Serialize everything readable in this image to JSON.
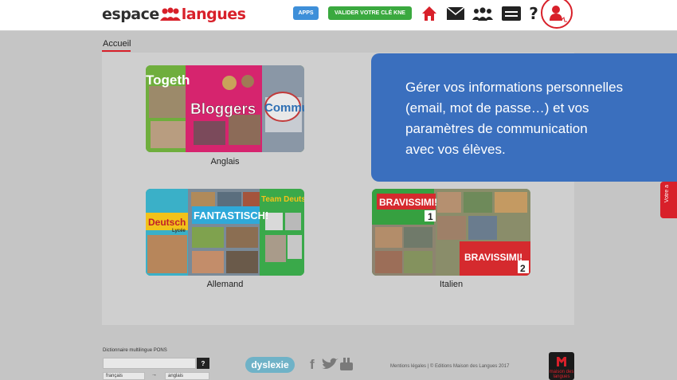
{
  "header": {
    "logo": {
      "part1": "espace",
      "part2": "langues"
    },
    "apps_label": "APPS",
    "kne_label": "VALIDER VOTRE CLÉ KNE",
    "help_label": "?"
  },
  "breadcrumb": {
    "label": "Accueil"
  },
  "cards": [
    {
      "label": "Anglais",
      "titles": [
        "Togeth",
        "Bloggers",
        "Commu"
      ]
    },
    {
      "label": "Allemand",
      "titles": [
        "Deutsch",
        "Lycée",
        "FANTASTISCH!",
        "Team Deutsch"
      ]
    },
    {
      "label": "Italien",
      "titles": [
        "BRAVISSIMI!",
        "1",
        "BRAVISSIMI!",
        "2"
      ]
    }
  ],
  "tooltip": {
    "lines": [
      "Gérer vos informations personnelles",
      "(email, mot de passe…) et vos",
      "paramètres de communication",
      "avec vos élèves."
    ]
  },
  "side_tab": {
    "label": "Votre a"
  },
  "footer": {
    "dictionary_title": "Dictionnaire multilingue PONS",
    "dictionary_btn": "?",
    "lang_from": "français",
    "lang_arrow": "→",
    "lang_to": "anglais",
    "dyslexie": "dyslexie",
    "mentions": "Mentions légales",
    "copyright": "| © Editions Maison des Langues 2017",
    "social": {
      "facebook": "f",
      "youtube": "You"
    },
    "mdl_logo": "maison des langues"
  },
  "colors": {
    "brand_red": "#d8202a",
    "tooltip_blue": "#3a6fbe",
    "apps_blue": "#3e8fd9",
    "kne_green": "#3aa93f"
  }
}
